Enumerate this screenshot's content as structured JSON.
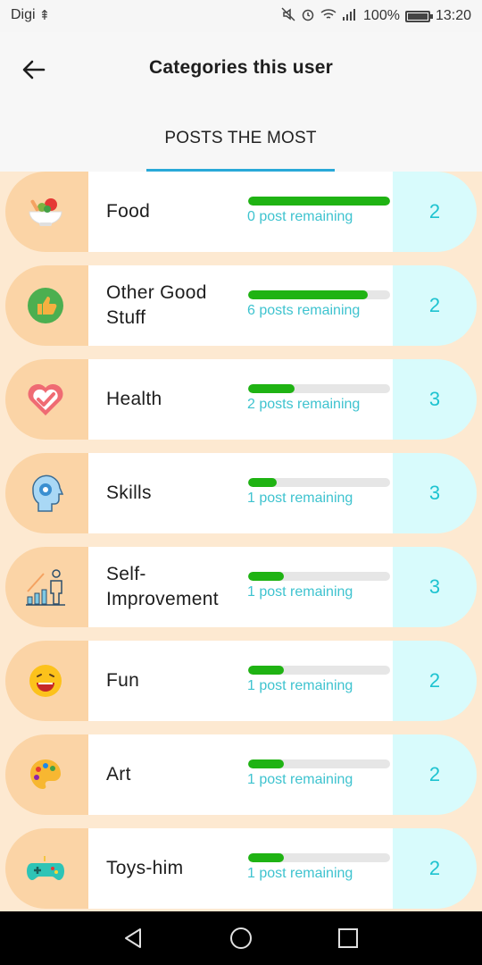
{
  "status_bar": {
    "carrier": "Digi",
    "usb_icon": "usb-icon",
    "battery_percent": "100%",
    "time": "13:20"
  },
  "header": {
    "back_icon": "back-arrow-icon",
    "title": "Categories this user",
    "tab_label": "POSTS THE MOST"
  },
  "colors": {
    "left_pill": "#fbd4a6",
    "right_pill": "#d8fbfc",
    "bar_fill": "#1fb313",
    "accent": "#1ec3d0",
    "tab_underline": "#29a9d8"
  },
  "categories": [
    {
      "name": "Food",
      "icon": "salad-bowl-icon",
      "progress": 1.0,
      "remaining": "0 post remaining",
      "count": "2"
    },
    {
      "name": "Other Good Stuff",
      "icon": "thumbs-up-icon",
      "progress": 0.84,
      "remaining": "6 posts remaining",
      "count": "2"
    },
    {
      "name": "Health",
      "icon": "heart-check-icon",
      "progress": 0.33,
      "remaining": "2 posts remaining",
      "count": "3"
    },
    {
      "name": "Skills",
      "icon": "head-gear-icon",
      "progress": 0.2,
      "remaining": "1 post remaining",
      "count": "3"
    },
    {
      "name": "Self-Improvement",
      "icon": "growth-chart-icon",
      "progress": 0.25,
      "remaining": "1 post remaining",
      "count": "3"
    },
    {
      "name": "Fun",
      "icon": "laughing-face-icon",
      "progress": 0.25,
      "remaining": "1 post remaining",
      "count": "2"
    },
    {
      "name": "Art",
      "icon": "paint-palette-icon",
      "progress": 0.25,
      "remaining": "1 post remaining",
      "count": "2"
    },
    {
      "name": "Toys-him",
      "icon": "gamepad-icon",
      "progress": 0.25,
      "remaining": "1 post remaining",
      "count": "2"
    }
  ],
  "nav_bar": {
    "back": "nav-back-icon",
    "home": "nav-home-icon",
    "recents": "nav-recents-icon"
  }
}
